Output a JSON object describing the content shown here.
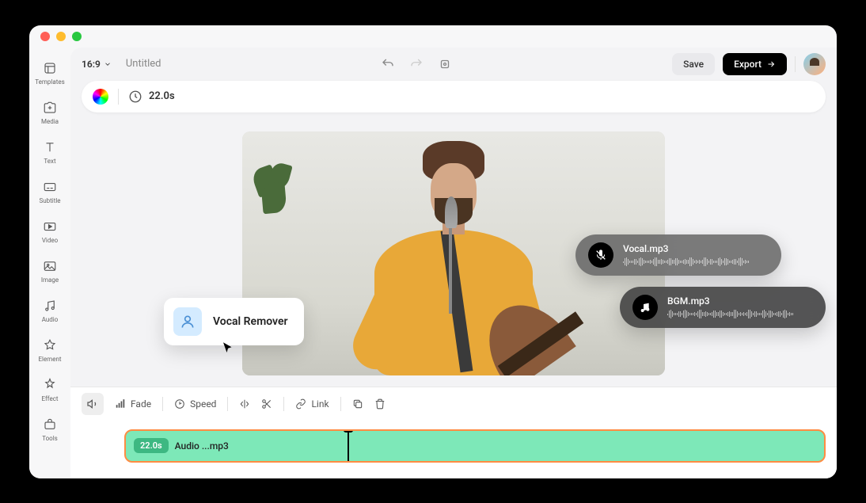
{
  "window": {
    "aspectRatio": "16:9",
    "title": "Untitled",
    "duration": "22.0s"
  },
  "sidebar": {
    "items": [
      {
        "label": "Templates",
        "icon": "templates"
      },
      {
        "label": "Media",
        "icon": "media"
      },
      {
        "label": "Text",
        "icon": "text"
      },
      {
        "label": "Subtitle",
        "icon": "subtitle"
      },
      {
        "label": "Video",
        "icon": "video"
      },
      {
        "label": "Image",
        "icon": "image"
      },
      {
        "label": "Audio",
        "icon": "audio"
      },
      {
        "label": "Element",
        "icon": "element"
      },
      {
        "label": "Effect",
        "icon": "effect"
      },
      {
        "label": "Tools",
        "icon": "tools"
      }
    ]
  },
  "actions": {
    "save": "Save",
    "export": "Export"
  },
  "tooltip": {
    "label": "Vocal Remover"
  },
  "floatingTracks": {
    "vocal": "Vocal.mp3",
    "bgm": "BGM.mp3"
  },
  "toolbar": {
    "fade": "Fade",
    "speed": "Speed",
    "link": "Link"
  },
  "timeline": {
    "clip": {
      "time": "22.0s",
      "name": "Audio ...mp3"
    }
  }
}
